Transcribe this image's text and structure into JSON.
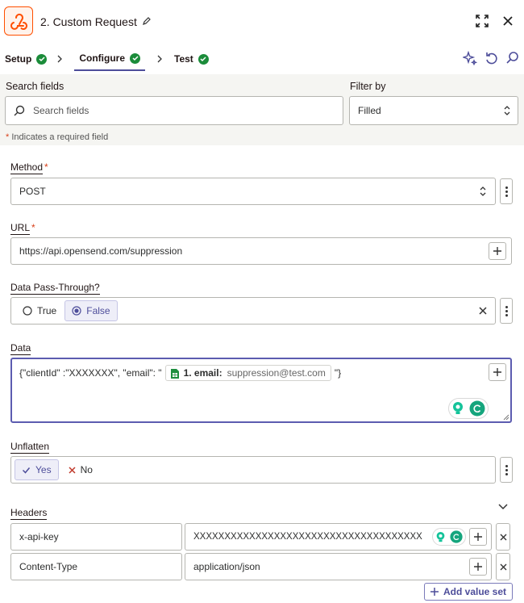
{
  "header": {
    "title": "2. Custom Request"
  },
  "steps": [
    {
      "label": "Setup"
    },
    {
      "label": "Configure"
    },
    {
      "label": "Test"
    }
  ],
  "search": {
    "label": "Search fields",
    "placeholder": "Search fields",
    "filter_label": "Filter by",
    "filter_value": "Filled"
  },
  "required_note": {
    "star": "*",
    "text": "Indicates a required field"
  },
  "method": {
    "label": "Method",
    "required": "*",
    "value": "POST"
  },
  "url": {
    "label": "URL",
    "required": "*",
    "value": "https://api.opensend.com/suppression"
  },
  "pass_through": {
    "label": "Data Pass-Through?",
    "option_true": "True",
    "option_false": "False",
    "selected": "False"
  },
  "data_field": {
    "label": "Data",
    "text_before": "{\"clientId\" :\"XXXXXXX\", \"email\": \"",
    "pill_label": "1. email:",
    "pill_value": "suppression@test.com",
    "text_after": "\"}"
  },
  "unflatten": {
    "label": "Unflatten",
    "option_yes": "Yes",
    "option_no": "No",
    "selected": "Yes"
  },
  "headers": {
    "label": "Headers",
    "rows": [
      {
        "key": "x-api-key",
        "value": "XXXXXXXXXXXXXXXXXXXXXXXXXXXXXXXXXXXXX"
      },
      {
        "key": "Content-Type",
        "value": "application/json"
      }
    ],
    "add_label": "Add value set"
  },
  "colors": {
    "accent": "#4d4d9a",
    "success": "#1b8c3a",
    "brand": "#ff4f00",
    "required": "#d8401a"
  }
}
